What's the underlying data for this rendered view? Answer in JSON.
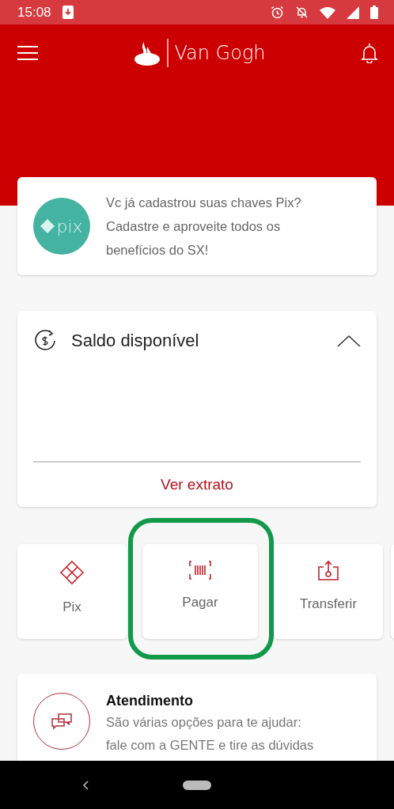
{
  "status_bar": {
    "time": "15:08"
  },
  "header": {
    "brand": "Van Gogh"
  },
  "pix_banner": {
    "logo_text": "pix",
    "message": "Vc já cadastrou suas chaves Pix? Cadastre e aproveite todos os benefícios do SX!"
  },
  "balance": {
    "title": "Saldo disponível",
    "expanded": true,
    "link": "Ver extrato"
  },
  "shortcuts": [
    {
      "kind": "pix",
      "label": "Pix",
      "highlighted": false
    },
    {
      "kind": "pay",
      "label": "Pagar",
      "highlighted": true
    },
    {
      "kind": "transfer",
      "label": "Transferir",
      "highlighted": false
    }
  ],
  "support": {
    "title": "Atendimento",
    "text": "São várias opções para te ajudar: fale com a GENTE e tire as dúvidas"
  }
}
